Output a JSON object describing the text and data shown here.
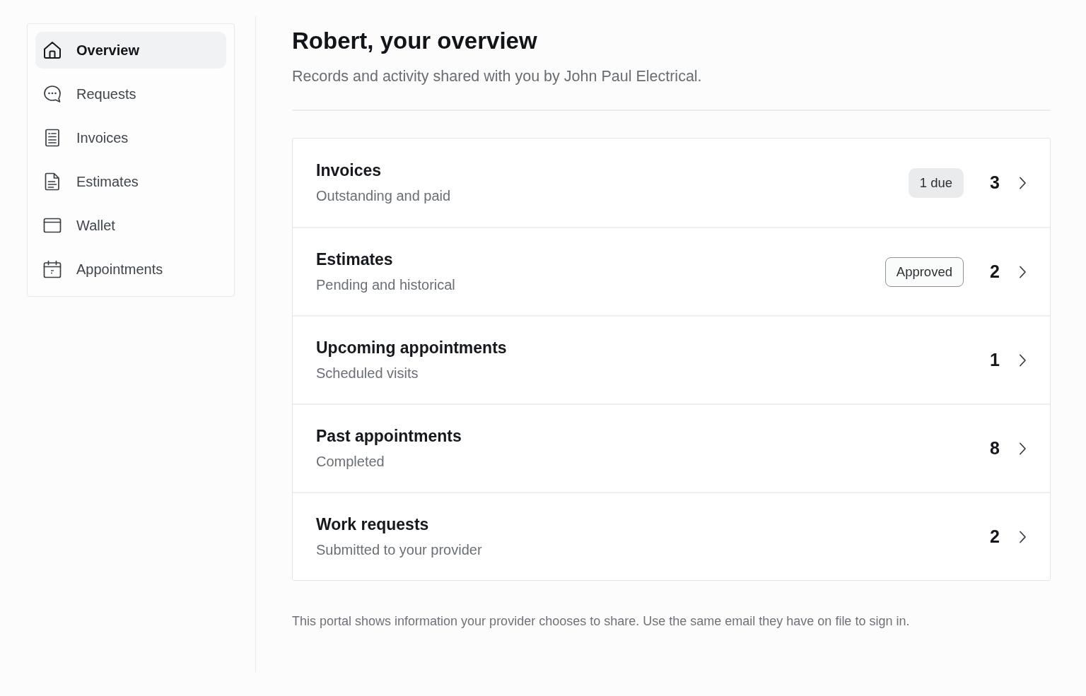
{
  "sidebar": {
    "items": [
      {
        "label": "Overview",
        "selected": true
      },
      {
        "label": "Requests",
        "selected": false
      },
      {
        "label": "Invoices",
        "selected": false
      },
      {
        "label": "Estimates",
        "selected": false
      },
      {
        "label": "Wallet",
        "selected": false
      },
      {
        "label": "Appointments",
        "selected": false
      }
    ]
  },
  "header": {
    "title": "Robert, your overview",
    "subtitle": "Records and activity shared with you by John Paul Electrical."
  },
  "summary": {
    "rows": [
      {
        "title": "Invoices",
        "subtitle": "Outstanding and paid",
        "badge": {
          "kind": "soft",
          "label": "1 due"
        },
        "count": "3"
      },
      {
        "title": "Estimates",
        "subtitle": "Pending and historical",
        "badge": {
          "kind": "outline",
          "label": "Approved"
        },
        "count": "2"
      },
      {
        "title": "Upcoming appointments",
        "subtitle": "Scheduled visits",
        "count": "1"
      },
      {
        "title": "Past appointments",
        "subtitle": "Completed",
        "count": "8"
      },
      {
        "title": "Work requests",
        "subtitle": "Submitted to your provider",
        "count": "2"
      }
    ]
  },
  "footer_note": "This portal shows information your provider chooses to share. Use the same email they have on file to sign in."
}
